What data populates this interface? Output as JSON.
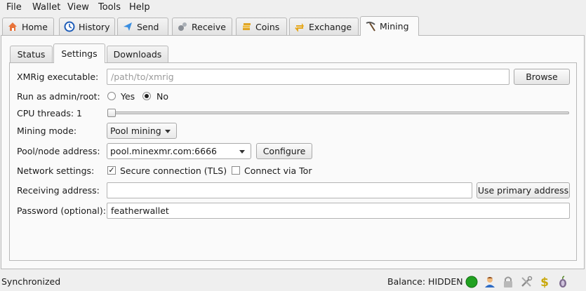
{
  "menu": [
    "File",
    "Wallet",
    "View",
    "Tools",
    "Help"
  ],
  "main_tabs": [
    {
      "label": "Home",
      "icon": "home-icon"
    },
    {
      "label": "History",
      "icon": "history-icon"
    },
    {
      "label": "Send",
      "icon": "send-icon"
    },
    {
      "label": "Receive",
      "icon": "receive-icon"
    },
    {
      "label": "Coins",
      "icon": "coins-icon"
    },
    {
      "label": "Exchange",
      "icon": "exchange-icon"
    },
    {
      "label": "Mining",
      "icon": "pickaxe-icon",
      "active": true
    }
  ],
  "sub_tabs": [
    {
      "label": "Status"
    },
    {
      "label": "Settings",
      "active": true
    },
    {
      "label": "Downloads"
    }
  ],
  "settings": {
    "xmrig_label": "XMRig executable:",
    "xmrig_placeholder": "/path/to/xmrig",
    "browse_label": "Browse",
    "admin_label": "Run as admin/root:",
    "admin_yes": "Yes",
    "admin_no": "No",
    "admin_selected": "No",
    "cpu_label": "CPU threads: 1",
    "cpu_threads": 1,
    "mode_label": "Mining mode:",
    "mode_value": "Pool mining",
    "pool_label": "Pool/node address:",
    "pool_value": "pool.minexmr.com:6666",
    "configure_label": "Configure",
    "network_label": "Network settings:",
    "tls_label": "Secure connection (TLS)",
    "tls_checked": true,
    "tor_label": "Connect via Tor",
    "tor_checked": false,
    "receiving_label": "Receiving address:",
    "receiving_value": "",
    "use_primary_label": "Use primary address",
    "password_label": "Password (optional):",
    "password_value": "featherwallet"
  },
  "status": {
    "sync_text": "Synchronized",
    "balance_text": "Balance: HIDDEN",
    "icons": [
      "connection-status-icon",
      "user-icon",
      "lock-icon",
      "settings-icon",
      "currency-icon",
      "tor-icon"
    ],
    "connection_color": "#21a121"
  }
}
